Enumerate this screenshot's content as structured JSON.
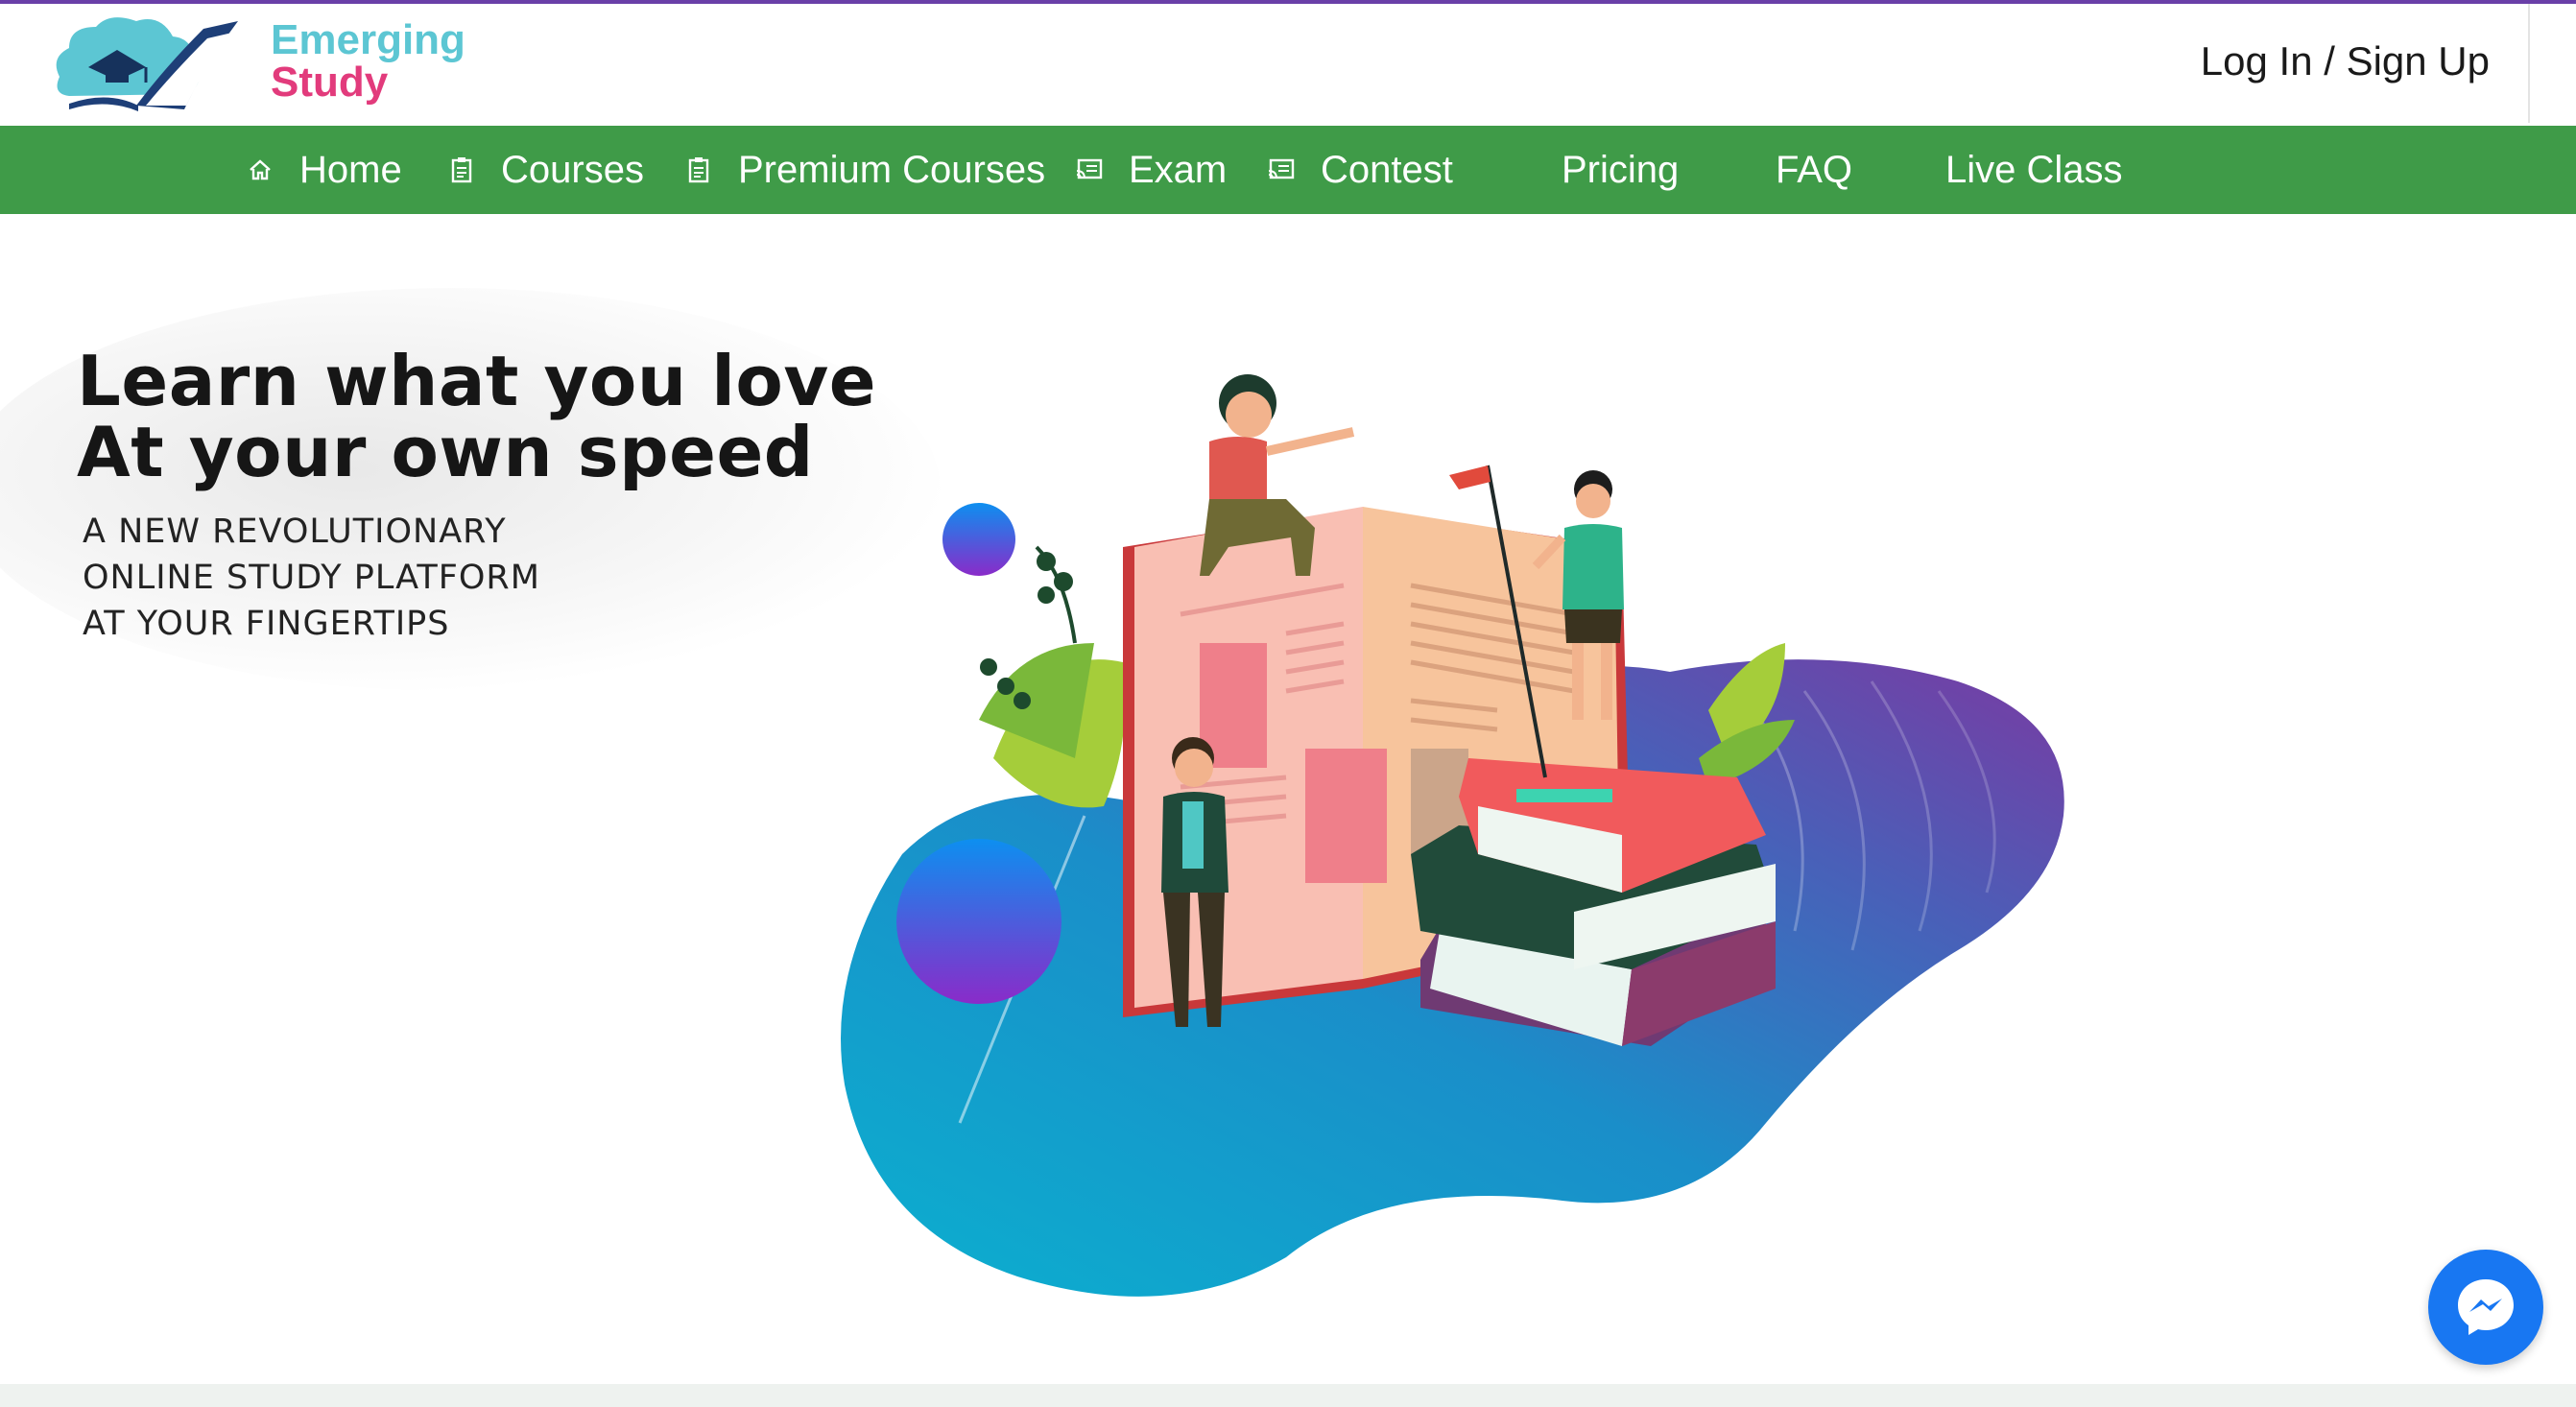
{
  "brand": {
    "line1": "Emerging",
    "line2": "Study"
  },
  "header": {
    "login_label": "Log In / Sign Up"
  },
  "nav": {
    "items": [
      {
        "label": "Home",
        "icon": "home-icon"
      },
      {
        "label": "Courses",
        "icon": "clipboard-icon"
      },
      {
        "label": "Premium Courses",
        "icon": "clipboard-icon"
      },
      {
        "label": "Exam",
        "icon": "cast-icon"
      },
      {
        "label": "Contest",
        "icon": "cast-icon"
      },
      {
        "label": "Pricing",
        "icon": ""
      },
      {
        "label": "FAQ",
        "icon": ""
      },
      {
        "label": "Live Class",
        "icon": ""
      }
    ]
  },
  "hero": {
    "title_line1": "Learn what you love",
    "title_line2": "At your own speed",
    "sub_line1": "A NEW REVOLUTIONARY",
    "sub_line2": "ONLINE STUDY PLATFORM",
    "sub_line3": "AT YOUR FINGERTIPS"
  },
  "colors": {
    "nav_green": "#3f9b48",
    "top_accent": "#6a3fa8",
    "messenger_blue": "#1877f2"
  },
  "chat": {
    "icon": "messenger-icon"
  }
}
